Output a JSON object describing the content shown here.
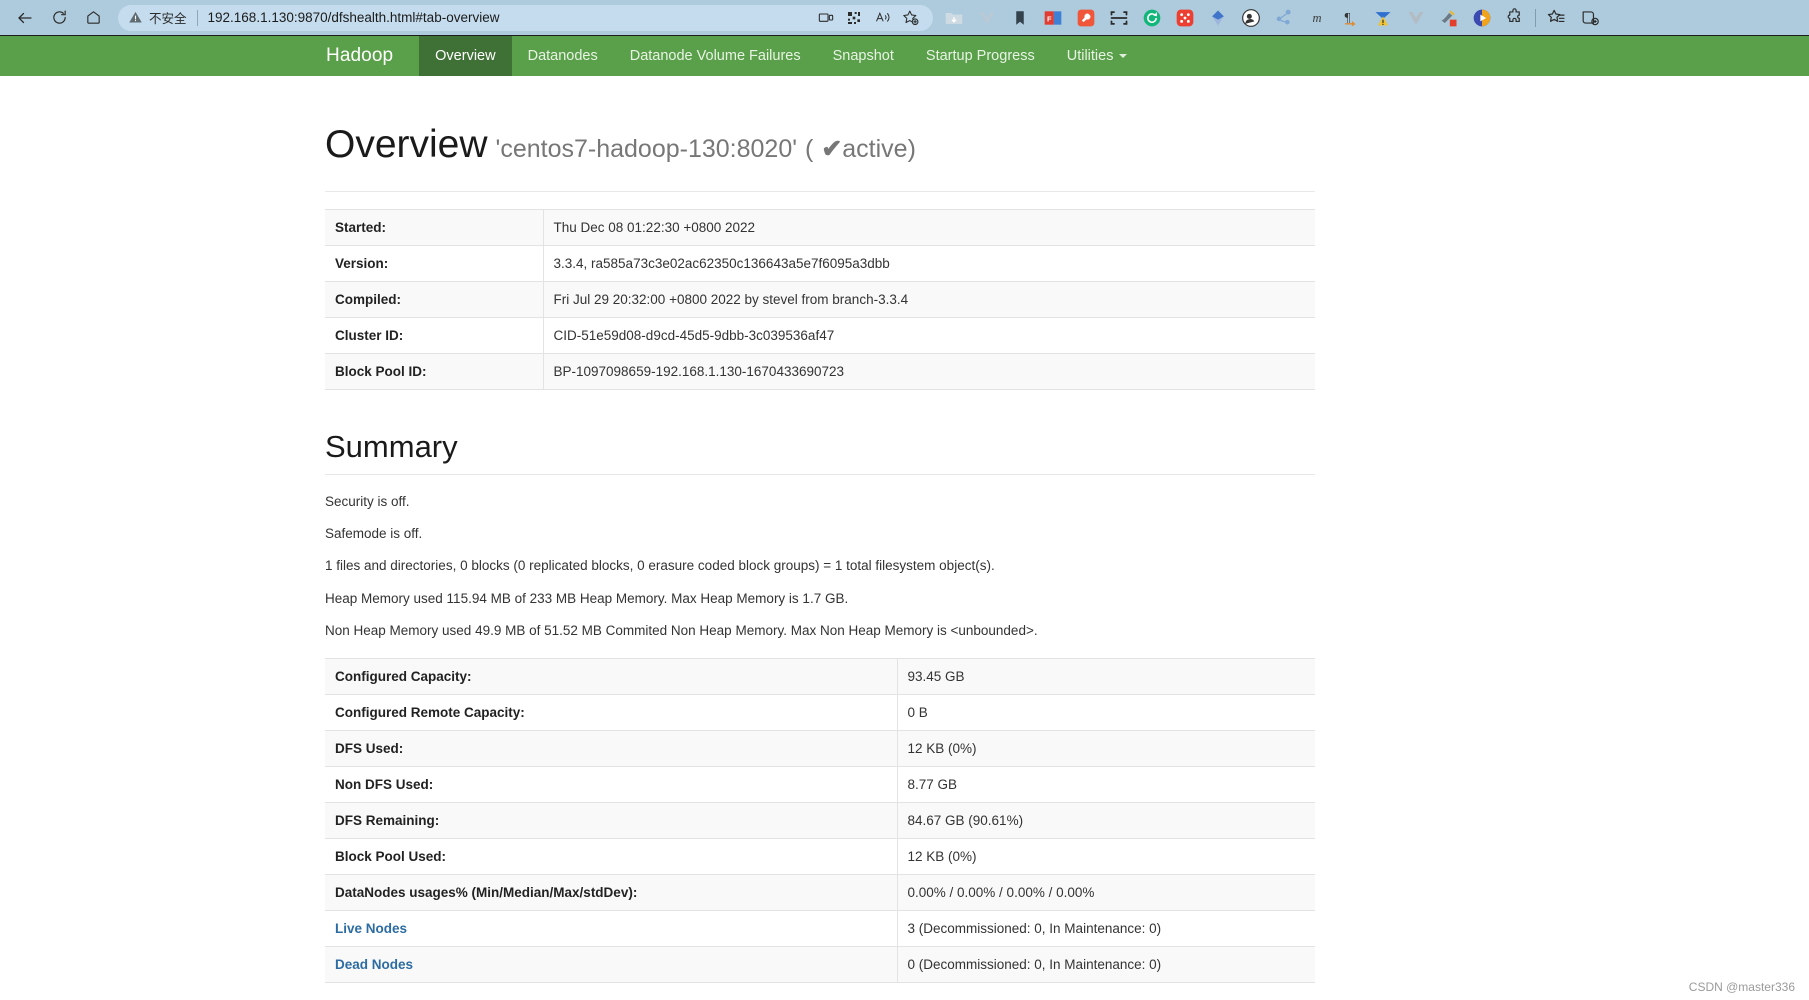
{
  "browser": {
    "back_icon": "back-arrow-icon",
    "reload_icon": "reload-icon",
    "home_icon": "home-icon",
    "security_label": "不安全",
    "url": "192.168.1.130:9870/dfshealth.html#tab-overview",
    "omnibox_actions": [
      "split-screen-icon",
      "collections-grid-icon",
      "read-aloud-icon",
      "add-favorite-icon"
    ],
    "extensions": [
      "folder-download-icon",
      "vue-devtools-icon",
      "bookmark-icon",
      "foxit-pdf-icon",
      "wrench-tool-icon",
      "scan-capture-icon",
      "sync-refresh-icon",
      "dice-red-icon",
      "diamond-blue-icon",
      "user-badge-icon",
      "graph-blue-icon",
      "markdown-m-icon",
      "pilcrow-icon",
      "warning-triangle-icon",
      "vue-grey-icon",
      "paint-brush-icon",
      "video-play-icon",
      "puzzle-extension-icon",
      "favorites-list-icon",
      "add-collection-icon"
    ]
  },
  "navbar": {
    "brand": "Hadoop",
    "items": [
      {
        "label": "Overview",
        "active": true
      },
      {
        "label": "Datanodes",
        "active": false
      },
      {
        "label": "Datanode Volume Failures",
        "active": false
      },
      {
        "label": "Snapshot",
        "active": false
      },
      {
        "label": "Startup Progress",
        "active": false
      },
      {
        "label": "Utilities",
        "active": false,
        "dropdown": true
      }
    ]
  },
  "overview": {
    "title": "Overview",
    "subject": "'centos7-hadoop-130:8020'",
    "status_open": "(",
    "status_check": "✔",
    "status_text": "active",
    "status_close": ")",
    "rows": [
      {
        "key": "Started:",
        "value": "Thu Dec 08 01:22:30 +0800 2022"
      },
      {
        "key": "Version:",
        "value": "3.3.4, ra585a73c3e02ac62350c136643a5e7f6095a3dbb"
      },
      {
        "key": "Compiled:",
        "value": "Fri Jul 29 20:32:00 +0800 2022 by stevel from branch-3.3.4"
      },
      {
        "key": "Cluster ID:",
        "value": "CID-51e59d08-d9cd-45d5-9dbb-3c039536af47"
      },
      {
        "key": "Block Pool ID:",
        "value": "BP-1097098659-192.168.1.130-1670433690723"
      }
    ]
  },
  "summary": {
    "title": "Summary",
    "lines": [
      "Security is off.",
      "Safemode is off.",
      "1 files and directories, 0 blocks (0 replicated blocks, 0 erasure coded block groups) = 1 total filesystem object(s).",
      "Heap Memory used 115.94 MB of 233 MB Heap Memory. Max Heap Memory is 1.7 GB.",
      "Non Heap Memory used 49.9 MB of 51.52 MB Commited Non Heap Memory. Max Non Heap Memory is <unbounded>."
    ],
    "rows": [
      {
        "key": "Configured Capacity:",
        "value": "93.45 GB",
        "link": false
      },
      {
        "key": "Configured Remote Capacity:",
        "value": "0 B",
        "link": false
      },
      {
        "key": "DFS Used:",
        "value": "12 KB (0%)",
        "link": false
      },
      {
        "key": "Non DFS Used:",
        "value": "8.77 GB",
        "link": false
      },
      {
        "key": "DFS Remaining:",
        "value": "84.67 GB (90.61%)",
        "link": false
      },
      {
        "key": "Block Pool Used:",
        "value": "12 KB (0%)",
        "link": false
      },
      {
        "key": "DataNodes usages% (Min/Median/Max/stdDev):",
        "value": "0.00% / 0.00% / 0.00% / 0.00%",
        "link": false
      },
      {
        "key": "Live Nodes",
        "value": "3 (Decommissioned: 0, In Maintenance: 0)",
        "link": true
      },
      {
        "key": "Dead Nodes",
        "value": "0 (Decommissioned: 0, In Maintenance: 0)",
        "link": true
      }
    ]
  },
  "watermark": "CSDN @master336",
  "colors": {
    "brand_green": "#5aa04a",
    "active_green": "#3f7035",
    "chrome_blue": "#adcbdc",
    "link_blue": "#2d6ca2"
  }
}
